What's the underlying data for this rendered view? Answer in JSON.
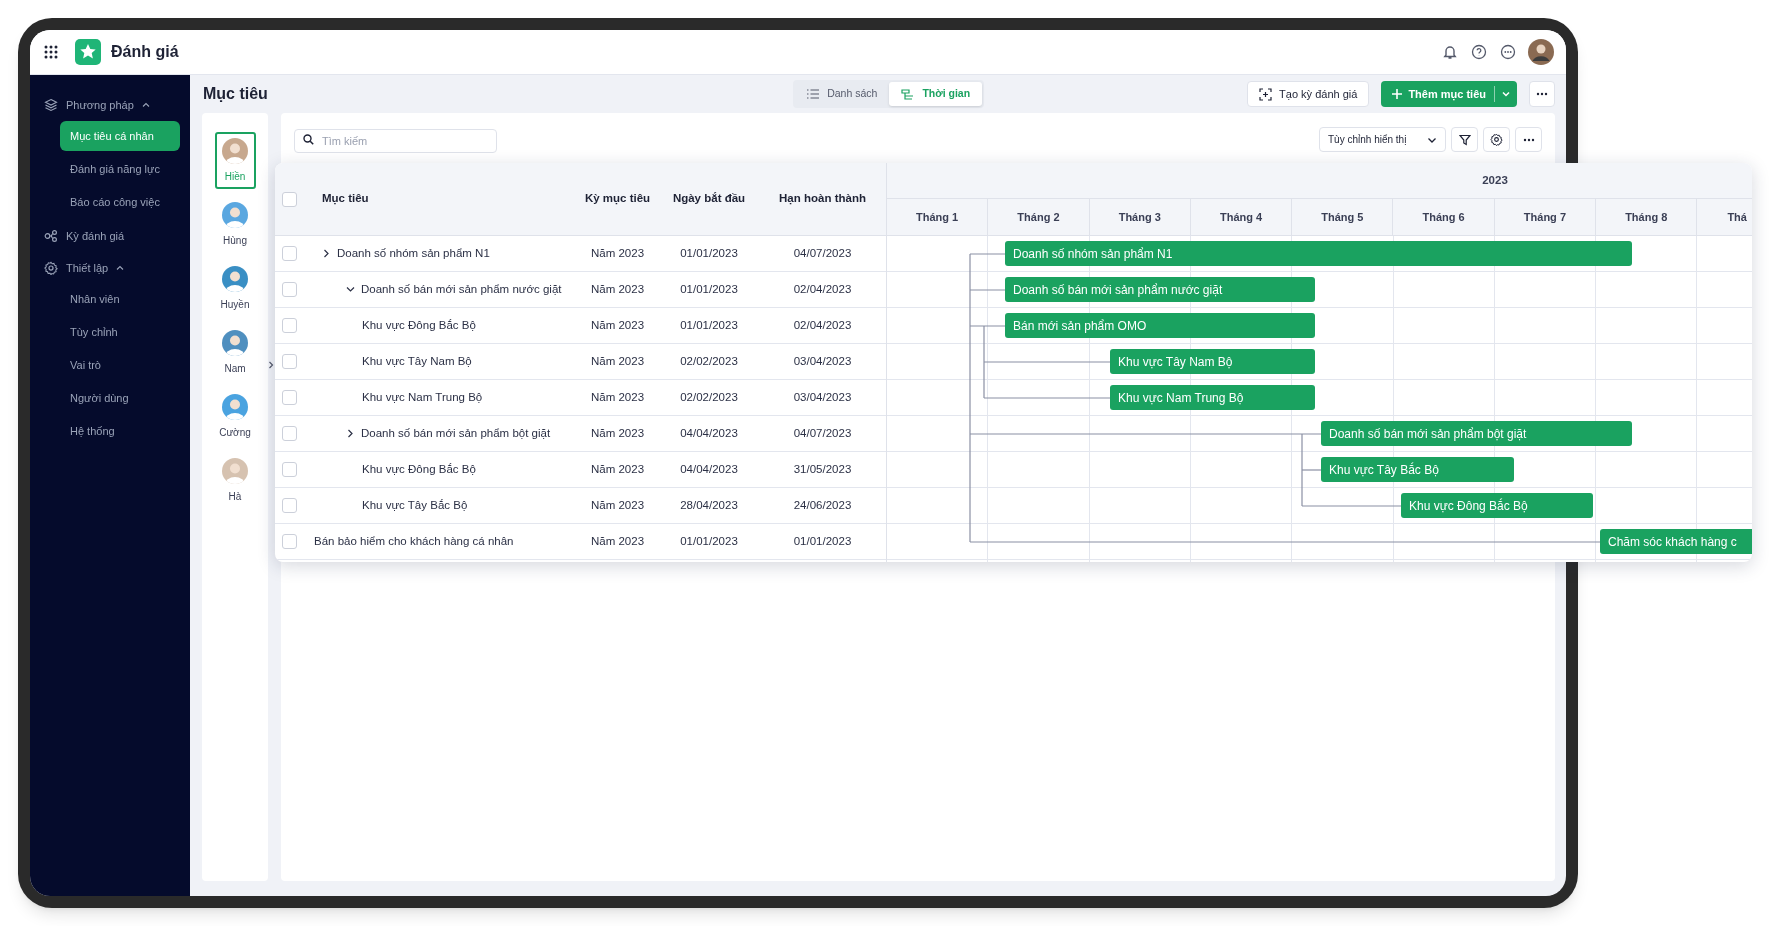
{
  "app": {
    "title": "Đánh giá"
  },
  "sidebar": {
    "items": [
      {
        "label": "Phương pháp",
        "expanded": true,
        "children": [
          {
            "label": "Mục tiêu cá nhân",
            "selected": true
          },
          {
            "label": "Đánh giá năng lực",
            "selected": false
          },
          {
            "label": "Báo cáo công việc",
            "selected": false
          }
        ]
      },
      {
        "label": "Kỳ đánh giá"
      },
      {
        "label": "Thiết lập",
        "expanded": true,
        "children": [
          {
            "label": "Nhân viên",
            "selected": false
          },
          {
            "label": "Tùy chỉnh",
            "selected": false
          },
          {
            "label": "Vai trò",
            "selected": false
          },
          {
            "label": "Người dùng",
            "selected": false
          },
          {
            "label": "Hệ thống",
            "selected": false
          }
        ]
      }
    ]
  },
  "page": {
    "title": "Mục tiêu",
    "view_tabs": [
      {
        "label": "Danh sách",
        "selected": false
      },
      {
        "label": "Thời gian",
        "selected": true
      }
    ],
    "actions": {
      "create": "Tạo kỳ đánh giá",
      "add": "Thêm mục tiêu"
    }
  },
  "people": [
    {
      "name": "Hiền",
      "selected": true
    },
    {
      "name": "Hùng",
      "selected": false
    },
    {
      "name": "Huyền",
      "selected": false
    },
    {
      "name": "Nam",
      "selected": false
    },
    {
      "name": "Cường",
      "selected": false
    },
    {
      "name": "Hà",
      "selected": false
    }
  ],
  "toolbar": {
    "search_placeholder": "Tìm kiếm",
    "display_dropdown": "Tùy chỉnh hiển thị"
  },
  "table": {
    "select_all_checked": false,
    "columns": [
      "Mục tiêu",
      "Kỳ mục tiêu",
      "Ngày bắt đầu",
      "Hạn hoàn thành"
    ],
    "rows": [
      {
        "name": "Doanh số nhóm sản phẩm N1",
        "period": "Năm 2023",
        "start": "01/01/2023",
        "due": "04/07/2023",
        "checked": false,
        "expanded": false,
        "children": [
          {
            "name": "Doanh số bán mới sản phẩm nước giặt",
            "period": "Năm 2023",
            "start": "01/01/2023",
            "due": "02/04/2023",
            "checked": false,
            "expanded": true,
            "children": [
              {
                "name": "Khu vực Đông Bắc Bộ",
                "period": "Năm 2023",
                "start": "01/01/2023",
                "due": "02/04/2023",
                "checked": false
              },
              {
                "name": "Khu vực Tây Nam Bộ",
                "period": "Năm 2023",
                "start": "02/02/2023",
                "due": "03/04/2023",
                "checked": false
              },
              {
                "name": "Khu vực Nam Trung Bộ",
                "period": "Năm 2023",
                "start": "02/02/2023",
                "due": "03/04/2023",
                "checked": false
              }
            ]
          },
          {
            "name": "Doanh số bán mới sản phẩm bột giặt",
            "period": "Năm 2023",
            "start": "04/04/2023",
            "due": "04/07/2023",
            "checked": false,
            "expanded": false,
            "children": [
              {
                "name": "Khu vực Đông Bắc Bộ",
                "period": "Năm 2023",
                "start": "04/04/2023",
                "due": "31/05/2023",
                "checked": false
              },
              {
                "name": "Khu vực Tây Bắc Bộ",
                "period": "Năm 2023",
                "start": "28/04/2023",
                "due": "24/06/2023",
                "checked": false
              }
            ]
          }
        ]
      },
      {
        "name": "Bán bảo hiểm cho khách hàng cá nhân",
        "period": "Năm 2023",
        "start": "01/01/2023",
        "due": "01/01/2023",
        "checked": false
      }
    ]
  },
  "timeline": {
    "year": "2023",
    "months": [
      "Tháng 1",
      "Tháng 2",
      "Tháng 3",
      "Tháng 4",
      "Tháng 5",
      "Tháng 6",
      "Tháng 7",
      "Tháng 8",
      "Thá"
    ],
    "bars": [
      {
        "label": "Doanh số nhóm sản phẩm N1"
      },
      {
        "label": "Doanh số bán mới sản phẩm nước giặt"
      },
      {
        "label": "Bán mới sản phẩm OMO"
      },
      {
        "label": "Khu vực Tây Nam Bộ"
      },
      {
        "label": "Khu vực Nam Trung Bộ"
      },
      {
        "label": "Doanh số bán mới sản phẩm bột giặt"
      },
      {
        "label": "Khu vực Tây Bắc Bộ"
      },
      {
        "label": "Khu vực Đông Bắc Bộ"
      },
      {
        "label": "Chăm sóc khách hàng c"
      }
    ]
  }
}
